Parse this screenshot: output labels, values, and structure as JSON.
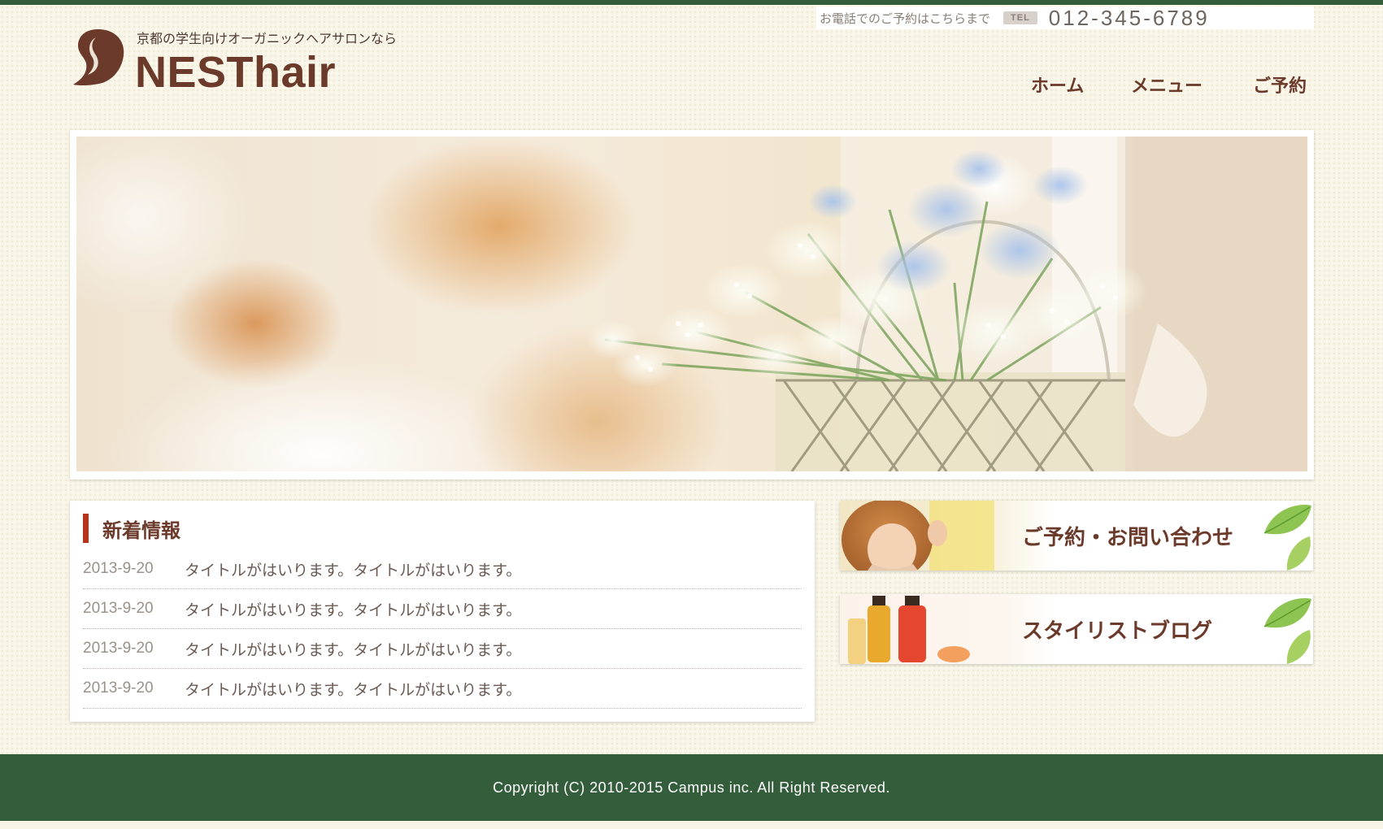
{
  "header": {
    "tagline": "京都の学生向けオーガニックヘアサロンなら",
    "brand": "NESThair",
    "phone_lead": "お電話でのご予約はこちらまで",
    "tel_badge": "TEL",
    "phone_number": "012-345-6789"
  },
  "nav": {
    "items": [
      {
        "label": "ホーム"
      },
      {
        "label": "メニュー"
      },
      {
        "label": "ご予約"
      }
    ]
  },
  "news": {
    "title": "新着情報",
    "items": [
      {
        "date": "2013-9-20",
        "title": "タイトルがはいります。タイトルがはいります。"
      },
      {
        "date": "2013-9-20",
        "title": "タイトルがはいります。タイトルがはいります。"
      },
      {
        "date": "2013-9-20",
        "title": "タイトルがはいります。タイトルがはいります。"
      },
      {
        "date": "2013-9-20",
        "title": "タイトルがはいります。タイトルがはいります。"
      }
    ]
  },
  "banners": {
    "contact": "ご予約・お問い合わせ",
    "blog": "スタイリストブログ"
  },
  "footer": {
    "copyright": "Copyright (C) 2010-2015 Campus inc. All Right Reserved."
  },
  "colors": {
    "brand_brown": "#6b3a2a",
    "footer_green": "#335d3b",
    "accent_red": "#b8321c",
    "page_bg": "#f8f5e6"
  },
  "icons": [
    "hair-silhouette-logo-icon",
    "leaf-icon"
  ]
}
